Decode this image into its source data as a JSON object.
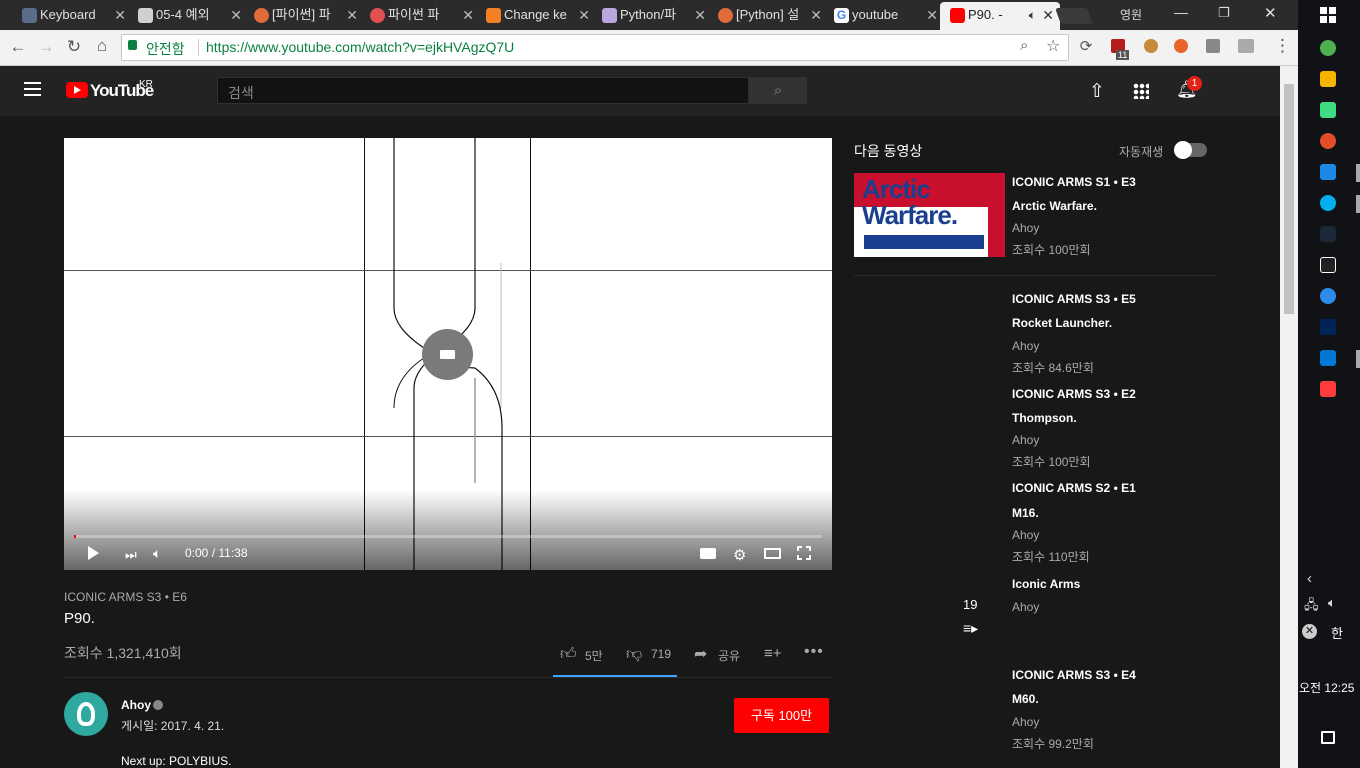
{
  "browser": {
    "tabs": [
      {
        "label": "Keyboard",
        "favicon_color": "#5a6e8c"
      },
      {
        "label": "05-4 예외",
        "favicon_color": "#d0d0d0"
      },
      {
        "label": "[파이썬] 파",
        "favicon_color": "#e06a3a"
      },
      {
        "label": "파이썬 파",
        "favicon_color": "#e05050"
      },
      {
        "label": "Change ke",
        "favicon_color": "#f48024"
      },
      {
        "label": "Python/파",
        "favicon_color": "#b9a8e0"
      },
      {
        "label": "[Python] 설",
        "favicon_color": "#e06a3a"
      },
      {
        "label": "youtube",
        "favicon_color": "#4285f4"
      },
      {
        "label": "P90. -",
        "favicon_color": "#ff0000"
      }
    ],
    "profile_label": "영원",
    "secure_label": "안전함",
    "url": "https://www.youtube.com/watch?v=ejkHVAgzQ7U",
    "notification_badge": "11"
  },
  "youtube": {
    "logo_text": "YouTube",
    "logo_region": "KR",
    "search_placeholder": "검색",
    "notif_count": "1",
    "player": {
      "time": "0:00 / 11:38",
      "progress_fraction": 0.0
    },
    "video": {
      "series": "ICONIC ARMS  S3 • E6",
      "title": "P90.",
      "views": "조회수 1,321,410회",
      "likes": "5만",
      "dislikes": "719",
      "share_label": "공유",
      "channel": "Ahoy",
      "published": "게시일: 2017. 4. 21.",
      "subscribe_label": "구독  100만",
      "description_first_line": "Next up: POLYBIUS."
    },
    "sidebar": {
      "up_next_label": "다음 동영상",
      "autoplay_label": "자동재생",
      "playlist_count": "19",
      "items": [
        {
          "series": "ICONIC ARMS  S1 • E3",
          "title": "Arctic Warfare.",
          "channel": "Ahoy",
          "views": "조회수 100만회",
          "thumb_line1": "Arctic",
          "thumb_line2": "Warfare."
        },
        {
          "series": "ICONIC ARMS  S3 • E5",
          "title": "Rocket Launcher.",
          "channel": "Ahoy",
          "views": "조회수 84.6만회"
        },
        {
          "series": "ICONIC ARMS  S3 • E2",
          "title": "Thompson.",
          "channel": "Ahoy",
          "views": "조회수 100만회"
        },
        {
          "series": "ICONIC ARMS  S2 • E1",
          "title": "M16.",
          "channel": "Ahoy",
          "views": "조회수 110만회"
        },
        {
          "series": "",
          "title": "Iconic Arms",
          "channel": "Ahoy",
          "views": ""
        },
        {
          "series": "ICONIC ARMS  S3 • E4",
          "title": "M60.",
          "channel": "Ahoy",
          "views": "조회수 99.2만회"
        }
      ]
    }
  },
  "taskbar": {
    "time": "오전 12:25",
    "ime": "한"
  }
}
